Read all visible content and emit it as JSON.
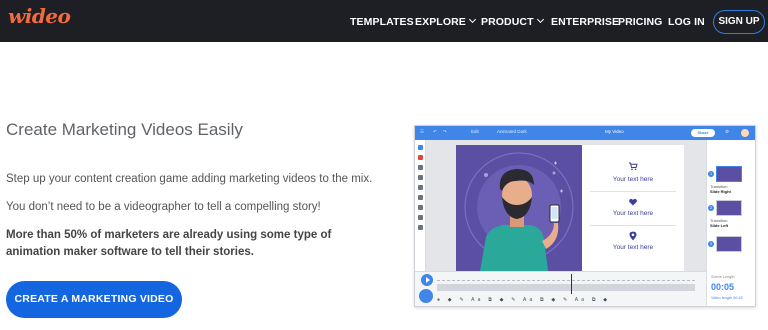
{
  "nav": {
    "logo": "wideo",
    "items": [
      {
        "label": "TEMPLATES",
        "dropdown": false
      },
      {
        "label": "EXPLORE",
        "dropdown": true
      },
      {
        "label": "PRODUCT",
        "dropdown": true
      },
      {
        "label": "ENTERPRISE",
        "dropdown": false
      },
      {
        "label": "PRICING",
        "dropdown": false
      },
      {
        "label": "LOG IN",
        "dropdown": false
      }
    ],
    "signup": "SIGN UP"
  },
  "hero": {
    "title": "Create Marketing Videos Easily",
    "p1": "Step up your content creation game adding marketing videos to the mix.",
    "p2": "You don’t need to be a videographer to tell a compelling story!",
    "p3": "More than 50% of marketers are already using some type of animation maker software to tell their stories.",
    "cta": "CREATE A MARKETING VIDEO"
  },
  "editor": {
    "project_title": "My Video",
    "share": "Share",
    "menu": [
      "Edit",
      "Animated Dark"
    ],
    "texts": [
      "Your text here",
      "Your text here",
      "Your text here"
    ],
    "scenes": [
      {
        "num": "1",
        "title": "Slide Right",
        "caption": "Transition"
      },
      {
        "num": "2",
        "title": "Slide Left",
        "caption": "Transition"
      },
      {
        "num": "3",
        "title": "",
        "caption": ""
      }
    ],
    "timer": {
      "label": "Scene Length",
      "value": "00:05",
      "sub": "Video length 00:15"
    }
  },
  "colors": {
    "nav_bg": "#1d1f24",
    "logo": "#f26a3e",
    "accent": "#1466e0",
    "editor_bar": "#3f86e8",
    "canvas_purple": "#5b4fa3"
  }
}
